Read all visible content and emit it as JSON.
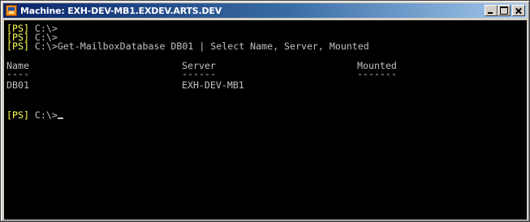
{
  "window": {
    "title": "Machine: EXH-DEV-MB1.EXDEV.ARTS.DEV",
    "icon": "powershell-remote-icon"
  },
  "console": {
    "prompt_tag": "[PS]",
    "prompt_path": " C:\\>",
    "command": "Get-MailboxDatabase DB01 | Select Name, Server, Mounted",
    "columns": {
      "name_header": "Name",
      "server_header": "Server",
      "mounted_header": "Mounted",
      "name_rule": "----",
      "server_rule": "------",
      "mounted_rule": "-------"
    },
    "row": {
      "name": "DB01",
      "server": "EXH-DEV-MB1",
      "mounted": ""
    }
  },
  "colors": {
    "console_bg": "#000000",
    "console_text": "#c0c0c0",
    "prompt_tag": "#ffff54",
    "titlebar": "#0a246a"
  }
}
